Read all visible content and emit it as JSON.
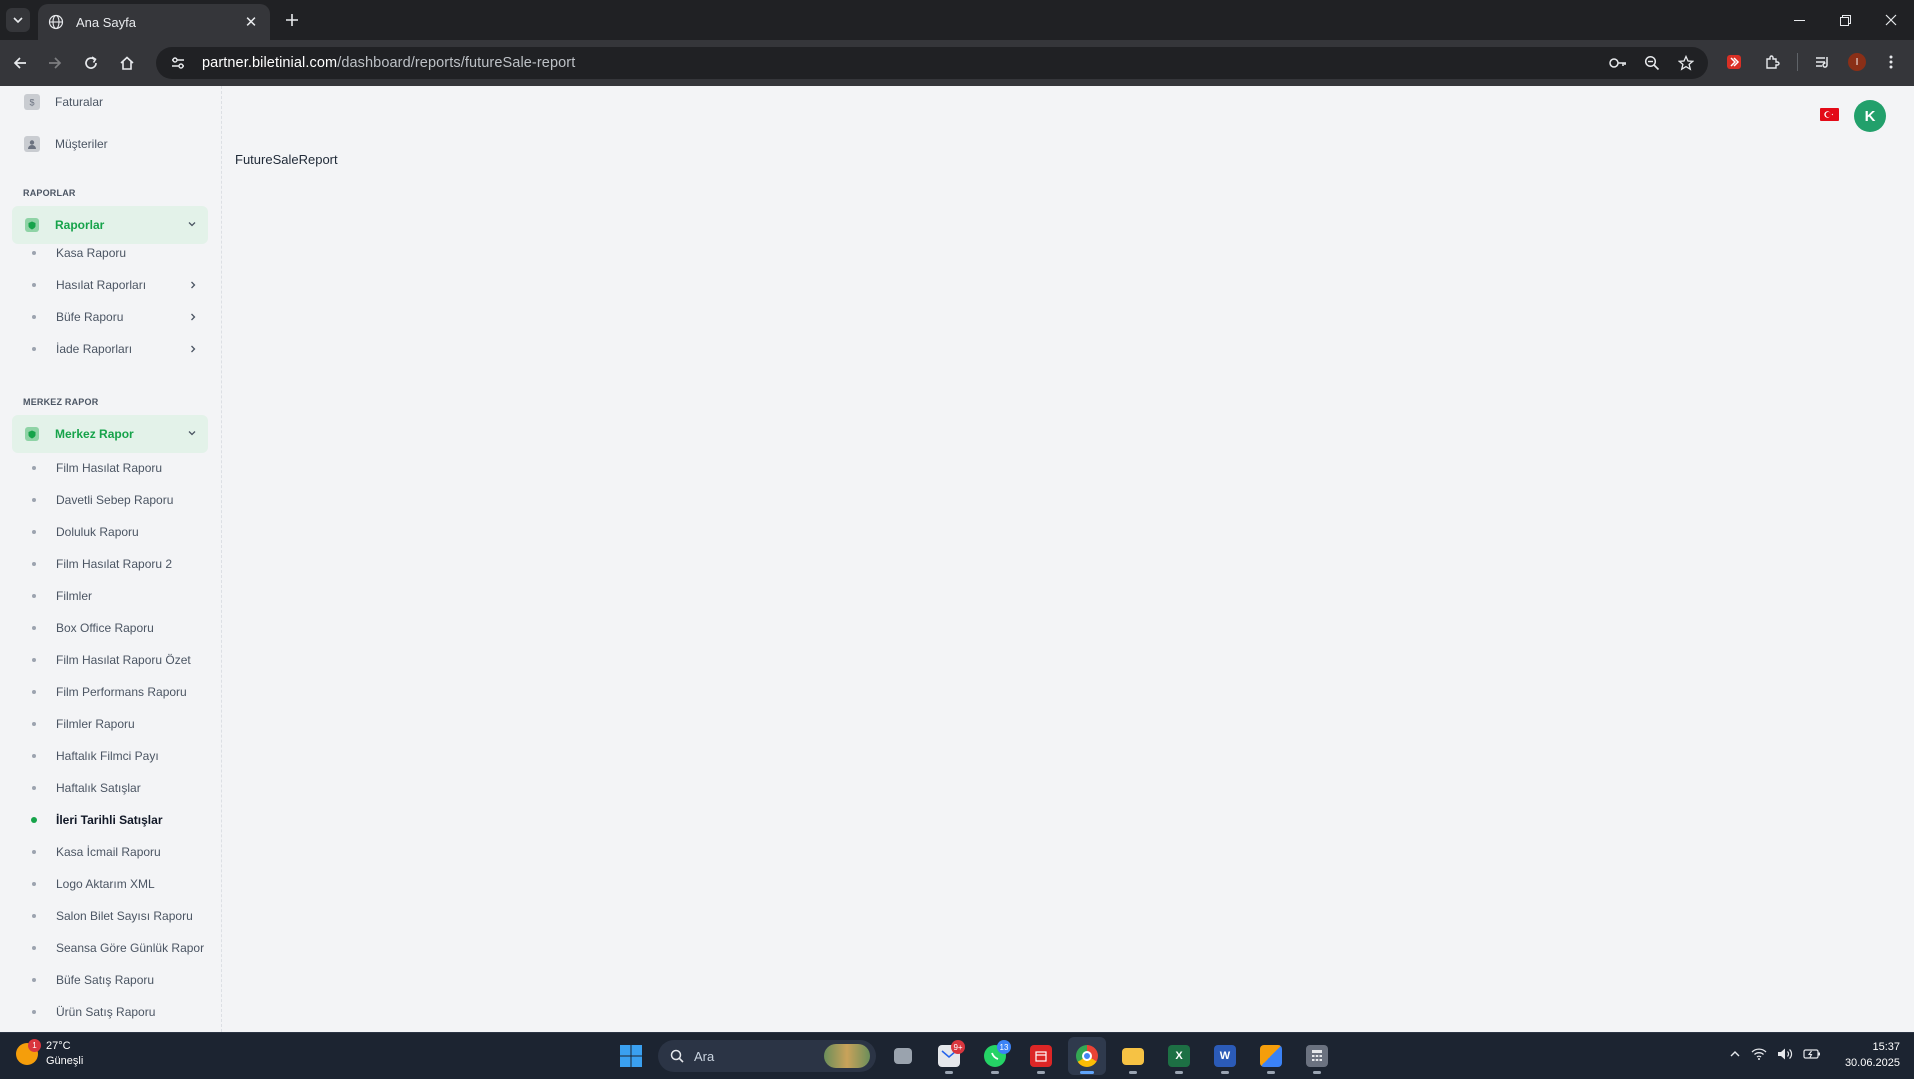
{
  "browser": {
    "tab_title": "Ana Sayfa",
    "url_host": "partner.biletinial.com",
    "url_path": "/dashboard/reports/futureSale-report",
    "profile_initial": "I"
  },
  "sidebar": {
    "top_items": [
      {
        "label": "Faturalar",
        "icon": "invoice-icon"
      },
      {
        "label": "Müşteriler",
        "icon": "customers-icon"
      }
    ],
    "reports_section": {
      "heading": "RAPORLAR",
      "group_label": "Raporlar",
      "items": [
        {
          "label": "Kasa Raporu",
          "has_children": false
        },
        {
          "label": "Hasılat Raporları",
          "has_children": true
        },
        {
          "label": "Büfe Raporu",
          "has_children": true
        },
        {
          "label": "İade Raporları",
          "has_children": true
        }
      ]
    },
    "central_section": {
      "heading": "MERKEZ RAPOR",
      "group_label": "Merkez Rapor",
      "items": [
        {
          "label": "Film Hasılat Raporu",
          "active": false
        },
        {
          "label": "Davetli Sebep Raporu",
          "active": false
        },
        {
          "label": "Doluluk Raporu",
          "active": false
        },
        {
          "label": "Film Hasılat Raporu 2",
          "active": false
        },
        {
          "label": "Filmler",
          "active": false
        },
        {
          "label": "Box Office Raporu",
          "active": false
        },
        {
          "label": "Film Hasılat Raporu Özet",
          "active": false
        },
        {
          "label": "Film Performans Raporu",
          "active": false
        },
        {
          "label": "Filmler Raporu",
          "active": false
        },
        {
          "label": "Haftalık Filmci Payı",
          "active": false
        },
        {
          "label": "Haftalık Satışlar",
          "active": false
        },
        {
          "label": "İleri Tarihli Satışlar",
          "active": true
        },
        {
          "label": "Kasa İcmail Raporu",
          "active": false
        },
        {
          "label": "Logo Aktarım XML",
          "active": false
        },
        {
          "label": "Salon Bilet Sayısı Raporu",
          "active": false
        },
        {
          "label": "Seansa Göre Günlük Rapor",
          "active": false
        },
        {
          "label": "Büfe Satış Raporu",
          "active": false
        },
        {
          "label": "Ürün Satış Raporu",
          "active": false
        }
      ]
    }
  },
  "header": {
    "user_initial": "K",
    "language_flag": "turkey-flag-icon"
  },
  "main": {
    "title": "FutureSaleReport"
  },
  "taskbar": {
    "weather_temp": "27°C",
    "weather_desc": "Güneşli",
    "weather_badge": "1",
    "search_placeholder": "Ara",
    "mail_badge": "9+",
    "whatsapp_badge": "13",
    "time": "15:37",
    "date": "30.06.2025"
  },
  "colors": {
    "accent_green": "#16a34a",
    "group_bg": "#e3f2e9",
    "avatar_bg": "#22a06b"
  }
}
